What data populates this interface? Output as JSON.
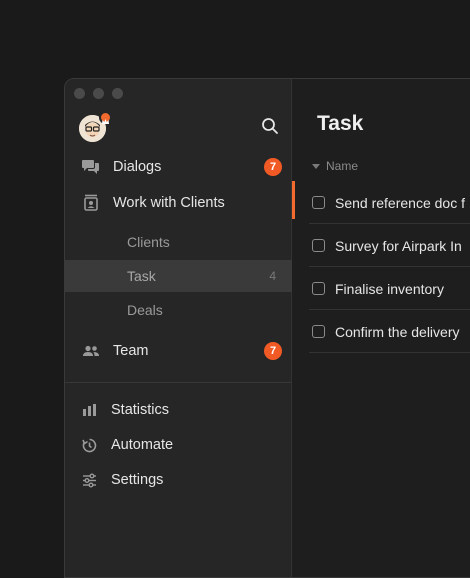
{
  "sidebar": {
    "nav": [
      {
        "label": "Dialogs",
        "badge": "7"
      },
      {
        "label": "Work with Clients"
      },
      {
        "label": "Team",
        "badge": "7"
      }
    ],
    "sub_items": [
      {
        "label": "Clients"
      },
      {
        "label": "Task",
        "count": "4",
        "active": true
      },
      {
        "label": "Deals"
      }
    ],
    "bottom": [
      {
        "label": "Statistics"
      },
      {
        "label": "Automate"
      },
      {
        "label": "Settings"
      }
    ]
  },
  "main": {
    "title": "Task",
    "column_header": "Name",
    "tasks": [
      {
        "label": "Send reference doc f",
        "selected": true
      },
      {
        "label": "Survey for Airpark In"
      },
      {
        "label": "Finalise inventory"
      },
      {
        "label": "Confirm the delivery"
      }
    ]
  },
  "colors": {
    "accent": "#f26a2e",
    "badge": "#f25a25",
    "bg": "#1a1a1a"
  },
  "icons": [
    "search-icon",
    "dialogs-icon",
    "clients-icon",
    "team-icon",
    "statistics-icon",
    "automate-icon",
    "settings-icon"
  ]
}
